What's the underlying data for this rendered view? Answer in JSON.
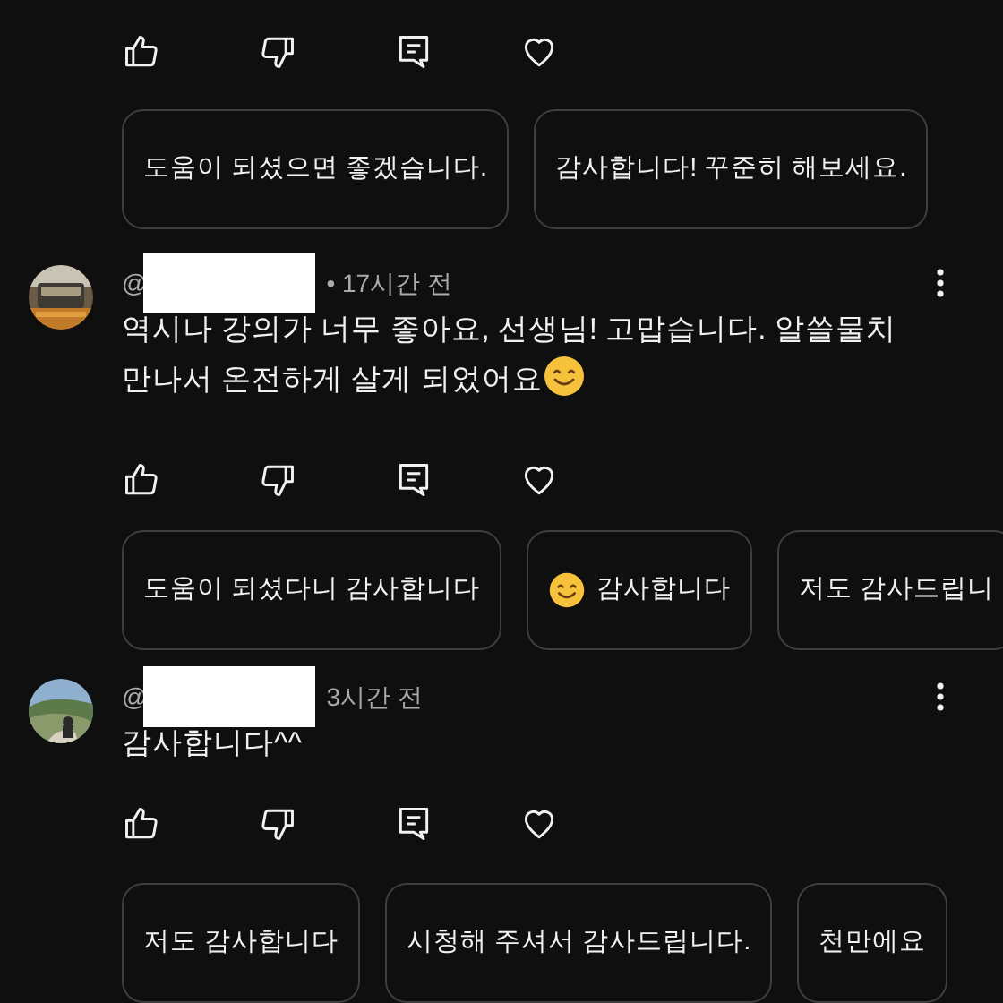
{
  "top": {
    "suggested_replies": [
      {
        "text": "도움이 되셨으면 좋겠습니다.",
        "emoji": false
      },
      {
        "text": "감사합니다! 꾸준히 해보세요.",
        "emoji": false
      }
    ]
  },
  "comments": [
    {
      "handle_prefix": "@",
      "time": "• 17시간 전",
      "text_lines": [
        "역시나 강의가 너무 좋아요, 선생님! 고맙습니다. 알쓸물치",
        "만나서 온전하게 살게 되었어요"
      ],
      "trailing_emoji": true,
      "suggested_replies": [
        {
          "text": "도움이 되셨다니 감사합니다",
          "emoji": false
        },
        {
          "text": "감사합니다",
          "emoji": true
        },
        {
          "text": "저도 감사드립니",
          "emoji": false
        }
      ]
    },
    {
      "handle_prefix": "@",
      "time": "3시간 전",
      "text_lines": [
        "감사합니다^^"
      ],
      "trailing_emoji": false,
      "suggested_replies": [
        {
          "text": "저도 감사합니다",
          "emoji": false
        },
        {
          "text": "시청해 주셔서 감사드립니다.",
          "emoji": false
        },
        {
          "text": "천만에요",
          "emoji": false
        }
      ]
    }
  ]
}
